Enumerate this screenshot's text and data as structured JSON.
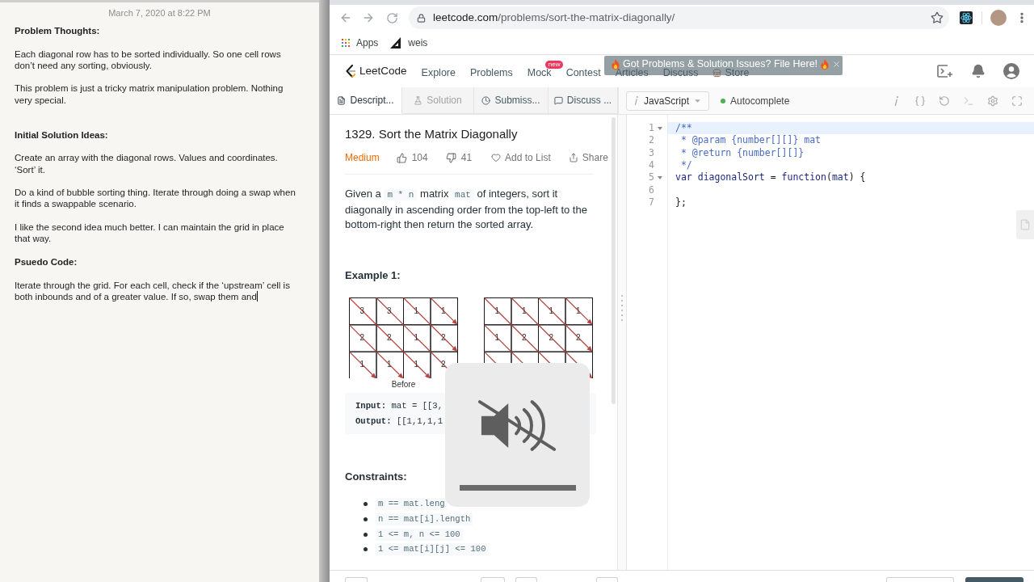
{
  "notes": {
    "timestamp": "March 7, 2020 at 8:22 PM",
    "blocks": [
      {
        "kind": "heading",
        "text": "Problem Thoughts:",
        "cursor": false
      },
      {
        "kind": "paragraph",
        "text": "Each diagonal row has to be sorted individually. So one cell rows don’t need any sorting, obviously.",
        "cursor": false
      },
      {
        "kind": "paragraph",
        "text": "This problem is just a tricky matrix manipulation problem. Nothing very special.",
        "cursor": false
      },
      {
        "kind": "blank",
        "cursor": false
      },
      {
        "kind": "heading",
        "text": "Initial Solution Ideas:",
        "cursor": false
      },
      {
        "kind": "paragraph",
        "text": "Create an array with the diagonal rows. Values and coordinates. ‘Sort’ it.",
        "cursor": false
      },
      {
        "kind": "paragraph",
        "text": "Do a kind of bubble sorting thing. Iterate through doing a swap when it finds a swappable scenario.",
        "cursor": false
      },
      {
        "kind": "paragraph",
        "text": "I like the second idea much better. I can maintain the grid in place that way.",
        "cursor": false
      },
      {
        "kind": "heading",
        "text": "Psuedo Code:",
        "cursor": false
      },
      {
        "kind": "paragraph",
        "text": "Iterate through the grid. For each cell, check if the ‘upstream’ cell is both inbounds and of a greater value. If so, swap them and",
        "cursor": true
      }
    ]
  },
  "browser": {
    "url": {
      "host": "leetcode.com",
      "path": "/problems/sort-the-matrix-diagonally/"
    },
    "bookmarks": [
      {
        "label": "Apps"
      },
      {
        "label": "weis"
      }
    ]
  },
  "site_nav": {
    "logo": "LeetCode",
    "links": [
      {
        "kind": "link",
        "label": "Explore"
      },
      {
        "kind": "link",
        "label": "Problems"
      },
      {
        "kind": "link",
        "label": "Mock",
        "badge": "new"
      },
      {
        "kind": "link",
        "label": "Contest"
      },
      {
        "kind": "link",
        "label": "Articles"
      },
      {
        "kind": "link",
        "label": "Discuss"
      },
      {
        "kind": "icon_link",
        "label": "Store"
      }
    ],
    "banner": "Got Problems & Solution Issues? File Here!"
  },
  "tabs": [
    {
      "label": "Descript...",
      "selected": true,
      "disabled": false
    },
    {
      "label": "Solution",
      "selected": false,
      "disabled": true
    },
    {
      "label": "Submiss...",
      "selected": false,
      "disabled": false
    },
    {
      "label": "Discuss ...",
      "selected": false,
      "disabled": false
    }
  ],
  "problem": {
    "title": "1329. Sort the Matrix Diagonally",
    "difficulty": "Medium",
    "likes": "104",
    "dislikes": "41",
    "actions": [
      {
        "label": "Add to List"
      },
      {
        "label": "Share"
      }
    ],
    "description": [
      {
        "kind": "text",
        "text": "Given a "
      },
      {
        "kind": "code",
        "text": "m * n"
      },
      {
        "kind": "text",
        "text": " matrix "
      },
      {
        "kind": "code",
        "text": "mat"
      },
      {
        "kind": "text",
        "text": " of integers, sort it diagonally in ascending order from the top-left to the bottom-right then return the sorted array."
      }
    ],
    "example": {
      "heading": "Example 1:",
      "grids": [
        {
          "caption": "Before",
          "rows": [
            [
              "3",
              "3",
              "1",
              "1"
            ],
            [
              "2",
              "2",
              "1",
              "2"
            ],
            [
              "1",
              "1",
              "1",
              "2"
            ]
          ]
        },
        {
          "rows": [
            [
              "1",
              "1",
              "1",
              "1"
            ],
            [
              "1",
              "2",
              "2",
              "2"
            ],
            [
              null,
              null,
              null,
              null
            ]
          ]
        }
      ],
      "io": [
        {
          "label": "Input:",
          "value": "mat = [[3,"
        },
        {
          "label": "Output:",
          "value": "[[1,1,1,1"
        }
      ]
    },
    "constraints": {
      "heading": "Constraints:",
      "items": [
        "m == mat.leng",
        "n == mat[i].length",
        "1 <= m, n <= 100",
        "1 <= mat[i][j] <= 100"
      ]
    }
  },
  "editor": {
    "language": "JavaScript",
    "autocomplete": {
      "label": "Autocomplete",
      "on": true
    },
    "lines": [
      {
        "number": "1",
        "foldable": true,
        "active": true,
        "tokens": [
          {
            "kind": "comment",
            "text": "/**"
          }
        ]
      },
      {
        "number": "2",
        "foldable": false,
        "active": false,
        "tokens": [
          {
            "kind": "comment",
            "text": " * @param {number[][]} mat"
          }
        ]
      },
      {
        "number": "3",
        "foldable": false,
        "active": false,
        "tokens": [
          {
            "kind": "comment",
            "text": " * @return {number[][]}"
          }
        ]
      },
      {
        "number": "4",
        "foldable": false,
        "active": false,
        "tokens": [
          {
            "kind": "comment",
            "text": " */"
          }
        ]
      },
      {
        "number": "5",
        "foldable": true,
        "active": false,
        "tokens": [
          {
            "kind": "keyword",
            "text": "var"
          },
          {
            "kind": "def",
            "text": " diagonalSort "
          },
          {
            "kind": "plain",
            "text": "= "
          },
          {
            "kind": "keyword",
            "text": "function"
          },
          {
            "kind": "plain",
            "text": "("
          },
          {
            "kind": "def",
            "text": "mat"
          },
          {
            "kind": "plain",
            "text": ") {"
          }
        ]
      },
      {
        "number": "6",
        "foldable": false,
        "active": false
      },
      {
        "number": "7",
        "foldable": false,
        "active": false,
        "tokens": [
          {
            "kind": "plain",
            "text": "};"
          }
        ]
      }
    ]
  },
  "volume_hud": {
    "muted": true
  }
}
